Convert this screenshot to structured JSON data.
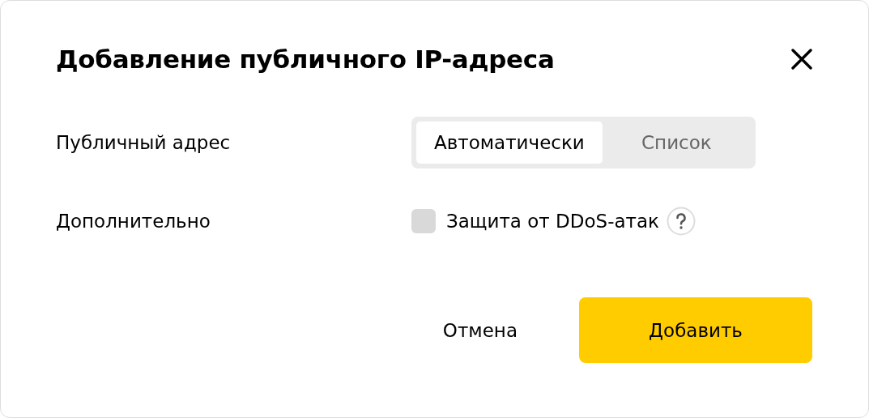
{
  "dialog": {
    "title": "Добавление публичного IP-адреса"
  },
  "fields": [
    {
      "kind": "segmented",
      "label": "Публичный адрес",
      "options": [
        {
          "label": "Автоматически",
          "selected": true
        },
        {
          "label": "Список",
          "selected": false
        }
      ]
    },
    {
      "kind": "checkbox",
      "label": "Дополнительно",
      "option": {
        "label": "Защита от DDoS-атак",
        "checked": false
      }
    }
  ],
  "buttons": [
    {
      "label": "Отмена",
      "kind": "plain"
    },
    {
      "label": "Добавить",
      "kind": "primary"
    }
  ]
}
